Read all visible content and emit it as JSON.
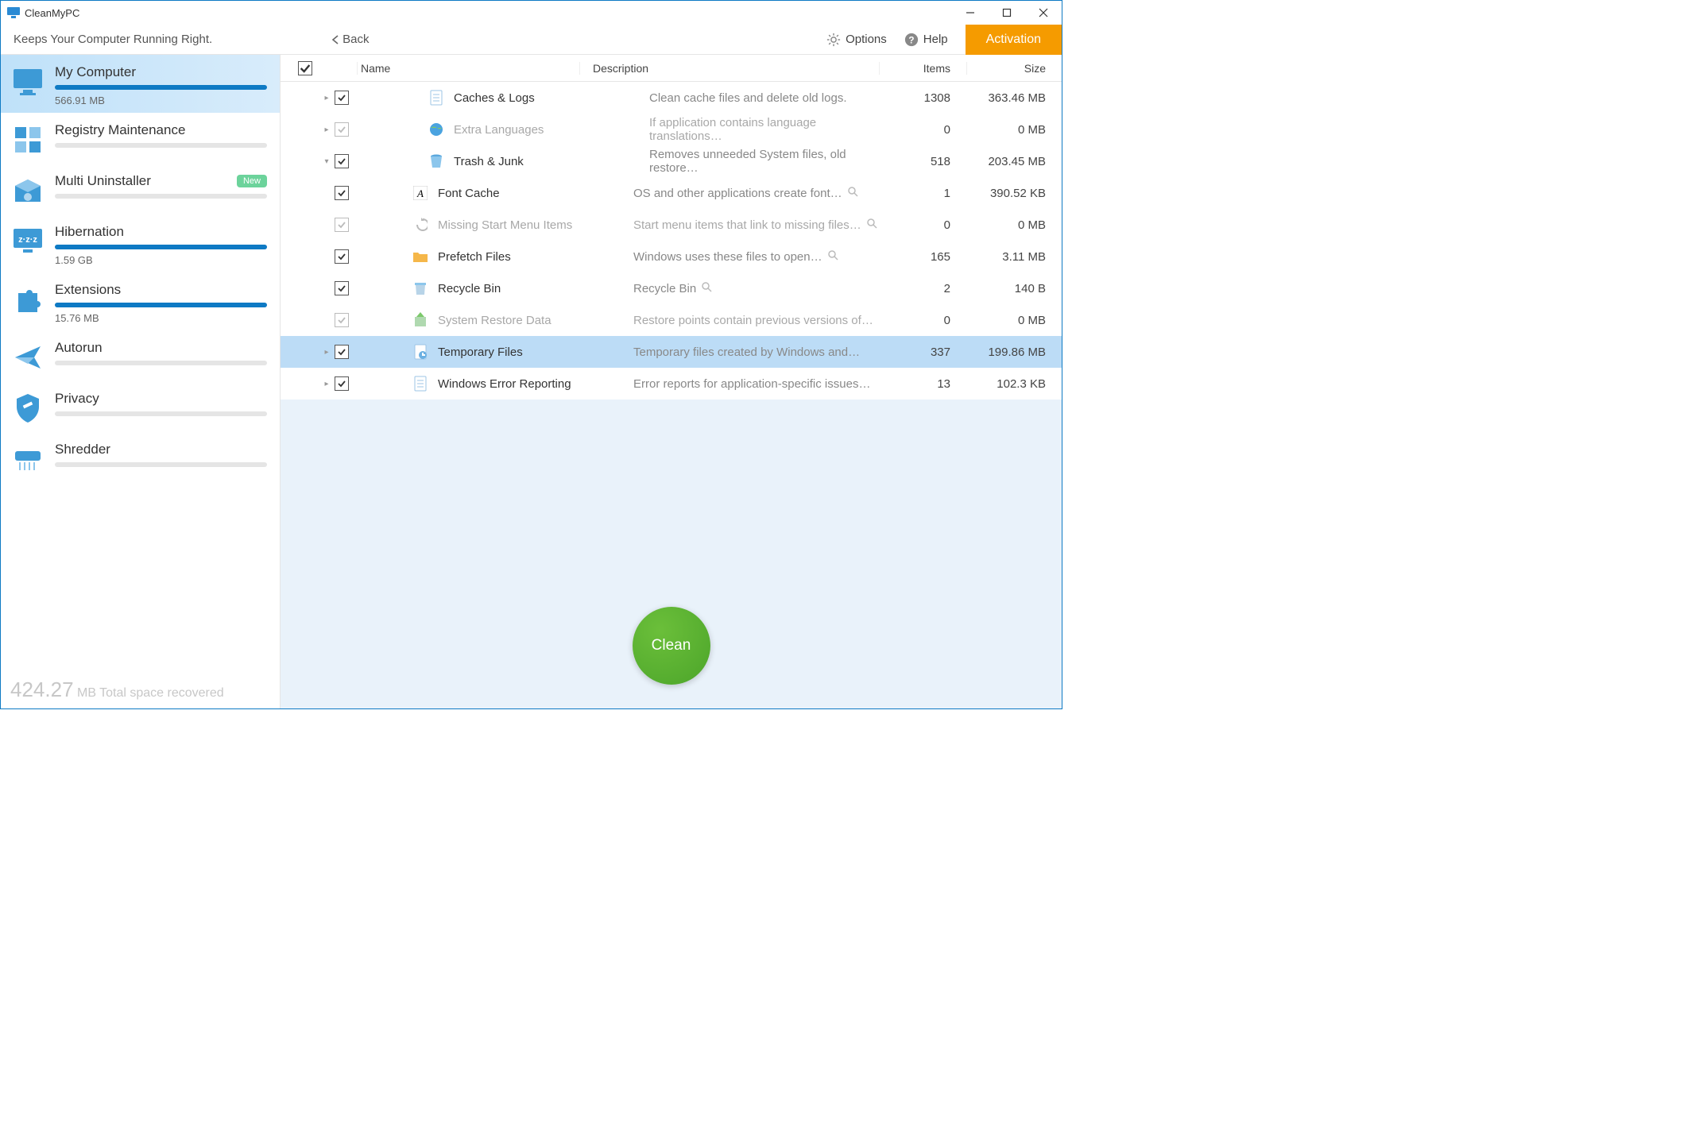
{
  "title": "CleanMyPC",
  "toolbar": {
    "tagline": "Keeps Your Computer Running Right.",
    "back": "Back",
    "options": "Options",
    "help": "Help",
    "activation": "Activation"
  },
  "sidebar": [
    {
      "title": "My Computer",
      "sub": "566.91 MB",
      "barFull": true,
      "active": true,
      "icon": "monitor"
    },
    {
      "title": "Registry Maintenance",
      "sub": "",
      "barFull": false,
      "icon": "registry"
    },
    {
      "title": "Multi Uninstaller",
      "sub": "",
      "barFull": false,
      "badge": "New",
      "icon": "box"
    },
    {
      "title": "Hibernation",
      "sub": "1.59 GB",
      "barFull": true,
      "icon": "sleep"
    },
    {
      "title": "Extensions",
      "sub": "15.76 MB",
      "barFull": true,
      "icon": "puzzle"
    },
    {
      "title": "Autorun",
      "sub": "",
      "barFull": false,
      "icon": "plane"
    },
    {
      "title": "Privacy",
      "sub": "",
      "barFull": false,
      "icon": "shield"
    },
    {
      "title": "Shredder",
      "sub": "",
      "barFull": false,
      "icon": "shredder"
    }
  ],
  "footer": {
    "value": "424.27",
    "unit": "MB Total space recovered"
  },
  "columns": {
    "name": "Name",
    "desc": "Description",
    "items": "Items",
    "size": "Size"
  },
  "rows": [
    {
      "level": 0,
      "arrow": "▸",
      "checked": true,
      "enabled": true,
      "icon": "doc",
      "name": "Caches & Logs",
      "desc": "Clean cache files and delete old logs.",
      "items": "1308",
      "size": "363.46 MB"
    },
    {
      "level": 0,
      "arrow": "▸",
      "checked": true,
      "enabled": false,
      "icon": "globe",
      "name": "Extra Languages",
      "desc": "If application contains language translations…",
      "items": "0",
      "size": "0 MB"
    },
    {
      "level": 0,
      "arrow": "▾",
      "checked": true,
      "enabled": true,
      "icon": "trash",
      "name": "Trash & Junk",
      "desc": "Removes unneeded System files, old restore…",
      "items": "518",
      "size": "203.45 MB"
    },
    {
      "level": 1,
      "arrow": "",
      "checked": true,
      "enabled": true,
      "icon": "font",
      "name": "Font Cache",
      "desc": "OS and other applications create font…",
      "items": "1",
      "size": "390.52 KB",
      "mag": true
    },
    {
      "level": 1,
      "arrow": "",
      "checked": true,
      "enabled": false,
      "icon": "missing",
      "name": "Missing Start Menu Items",
      "desc": "Start menu items that link to missing files…",
      "items": "0",
      "size": "0 MB",
      "mag": true
    },
    {
      "level": 1,
      "arrow": "",
      "checked": true,
      "enabled": true,
      "icon": "folder",
      "name": "Prefetch Files",
      "desc": "Windows uses these files to open…",
      "items": "165",
      "size": "3.11 MB",
      "mag": true
    },
    {
      "level": 1,
      "arrow": "",
      "checked": true,
      "enabled": true,
      "icon": "bin",
      "name": " Recycle Bin",
      "desc": "Recycle Bin",
      "items": "2",
      "size": "140 B",
      "mag": true
    },
    {
      "level": 1,
      "arrow": "",
      "checked": true,
      "enabled": false,
      "icon": "restore",
      "name": "System Restore Data",
      "desc": "Restore points contain previous versions of…",
      "items": "0",
      "size": "0 MB"
    },
    {
      "level": 1,
      "arrow": "▸",
      "checked": true,
      "enabled": true,
      "selected": true,
      "icon": "temp",
      "name": "Temporary Files",
      "desc": "Temporary files created by Windows and…",
      "items": "337",
      "size": "199.86 MB"
    },
    {
      "level": 1,
      "arrow": "▸",
      "checked": true,
      "enabled": true,
      "icon": "doc",
      "name": "Windows Error Reporting",
      "desc": "Error reports for application-specific issues…",
      "items": "13",
      "size": "102.3 KB"
    }
  ],
  "cleanButton": "Clean"
}
